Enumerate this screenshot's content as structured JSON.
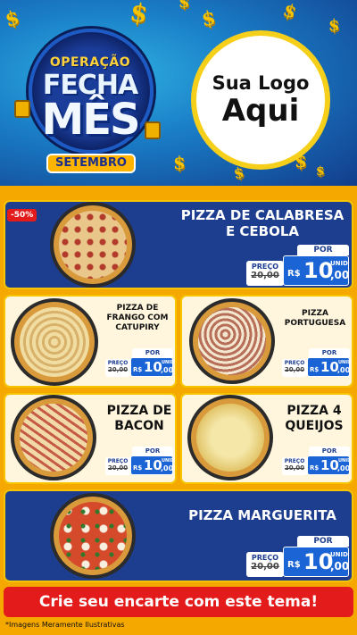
{
  "header": {
    "badge_line1": "OPERAÇÃO",
    "badge_line2": "FECHA",
    "badge_line3": "MÊS",
    "badge_line4": "SETEMBRO",
    "logo_line1": "Sua Logo",
    "logo_line2": "Aqui",
    "dollar_symbol": "$"
  },
  "discount_tag": "-50%",
  "price_labels": {
    "preco": "PREÇO",
    "por": "POR",
    "currency": "R$",
    "unid": "UNID"
  },
  "products": [
    {
      "name": "PIZZA DE CALABRESA E CEBOLA",
      "old_price": "20,00",
      "new_int": "10",
      "new_dec": ",00"
    },
    {
      "name": "PIZZA DE FRANGO COM CATUPIRY",
      "old_price": "20,00",
      "new_int": "10",
      "new_dec": ",00"
    },
    {
      "name": "PIZZA PORTUGUESA",
      "old_price": "20,00",
      "new_int": "10",
      "new_dec": ",00"
    },
    {
      "name": "PIZZA DE BACON",
      "old_price": "20,00",
      "new_int": "10",
      "new_dec": ",00"
    },
    {
      "name": "PIZZA 4 QUEIJOS",
      "old_price": "20,00",
      "new_int": "10",
      "new_dec": ",00"
    },
    {
      "name": "PIZZA MARGUERITA",
      "old_price": "20,00",
      "new_int": "10",
      "new_dec": ",00"
    }
  ],
  "cta": "Crie seu encarte com este tema!",
  "footnote": "*Imagens Meramente Ilustrativas",
  "colors": {
    "panel_blue": "#1d3d8f",
    "accent_yellow": "#f6c400",
    "cta_red": "#e41b1b",
    "price_blue": "#1a64d6"
  }
}
